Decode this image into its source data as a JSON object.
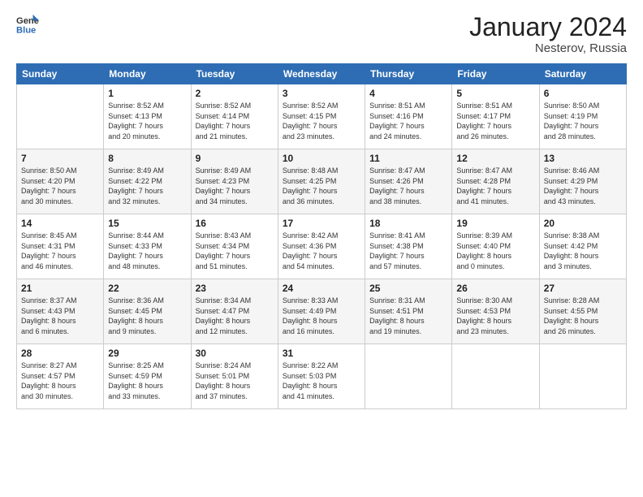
{
  "header": {
    "logo_general": "General",
    "logo_blue": "Blue",
    "month_title": "January 2024",
    "location": "Nesterov, Russia"
  },
  "weekdays": [
    "Sunday",
    "Monday",
    "Tuesday",
    "Wednesday",
    "Thursday",
    "Friday",
    "Saturday"
  ],
  "weeks": [
    [
      {
        "day": "",
        "info": ""
      },
      {
        "day": "1",
        "info": "Sunrise: 8:52 AM\nSunset: 4:13 PM\nDaylight: 7 hours\nand 20 minutes."
      },
      {
        "day": "2",
        "info": "Sunrise: 8:52 AM\nSunset: 4:14 PM\nDaylight: 7 hours\nand 21 minutes."
      },
      {
        "day": "3",
        "info": "Sunrise: 8:52 AM\nSunset: 4:15 PM\nDaylight: 7 hours\nand 23 minutes."
      },
      {
        "day": "4",
        "info": "Sunrise: 8:51 AM\nSunset: 4:16 PM\nDaylight: 7 hours\nand 24 minutes."
      },
      {
        "day": "5",
        "info": "Sunrise: 8:51 AM\nSunset: 4:17 PM\nDaylight: 7 hours\nand 26 minutes."
      },
      {
        "day": "6",
        "info": "Sunrise: 8:50 AM\nSunset: 4:19 PM\nDaylight: 7 hours\nand 28 minutes."
      }
    ],
    [
      {
        "day": "7",
        "info": "Sunrise: 8:50 AM\nSunset: 4:20 PM\nDaylight: 7 hours\nand 30 minutes."
      },
      {
        "day": "8",
        "info": "Sunrise: 8:49 AM\nSunset: 4:22 PM\nDaylight: 7 hours\nand 32 minutes."
      },
      {
        "day": "9",
        "info": "Sunrise: 8:49 AM\nSunset: 4:23 PM\nDaylight: 7 hours\nand 34 minutes."
      },
      {
        "day": "10",
        "info": "Sunrise: 8:48 AM\nSunset: 4:25 PM\nDaylight: 7 hours\nand 36 minutes."
      },
      {
        "day": "11",
        "info": "Sunrise: 8:47 AM\nSunset: 4:26 PM\nDaylight: 7 hours\nand 38 minutes."
      },
      {
        "day": "12",
        "info": "Sunrise: 8:47 AM\nSunset: 4:28 PM\nDaylight: 7 hours\nand 41 minutes."
      },
      {
        "day": "13",
        "info": "Sunrise: 8:46 AM\nSunset: 4:29 PM\nDaylight: 7 hours\nand 43 minutes."
      }
    ],
    [
      {
        "day": "14",
        "info": "Sunrise: 8:45 AM\nSunset: 4:31 PM\nDaylight: 7 hours\nand 46 minutes."
      },
      {
        "day": "15",
        "info": "Sunrise: 8:44 AM\nSunset: 4:33 PM\nDaylight: 7 hours\nand 48 minutes."
      },
      {
        "day": "16",
        "info": "Sunrise: 8:43 AM\nSunset: 4:34 PM\nDaylight: 7 hours\nand 51 minutes."
      },
      {
        "day": "17",
        "info": "Sunrise: 8:42 AM\nSunset: 4:36 PM\nDaylight: 7 hours\nand 54 minutes."
      },
      {
        "day": "18",
        "info": "Sunrise: 8:41 AM\nSunset: 4:38 PM\nDaylight: 7 hours\nand 57 minutes."
      },
      {
        "day": "19",
        "info": "Sunrise: 8:39 AM\nSunset: 4:40 PM\nDaylight: 8 hours\nand 0 minutes."
      },
      {
        "day": "20",
        "info": "Sunrise: 8:38 AM\nSunset: 4:42 PM\nDaylight: 8 hours\nand 3 minutes."
      }
    ],
    [
      {
        "day": "21",
        "info": "Sunrise: 8:37 AM\nSunset: 4:43 PM\nDaylight: 8 hours\nand 6 minutes."
      },
      {
        "day": "22",
        "info": "Sunrise: 8:36 AM\nSunset: 4:45 PM\nDaylight: 8 hours\nand 9 minutes."
      },
      {
        "day": "23",
        "info": "Sunrise: 8:34 AM\nSunset: 4:47 PM\nDaylight: 8 hours\nand 12 minutes."
      },
      {
        "day": "24",
        "info": "Sunrise: 8:33 AM\nSunset: 4:49 PM\nDaylight: 8 hours\nand 16 minutes."
      },
      {
        "day": "25",
        "info": "Sunrise: 8:31 AM\nSunset: 4:51 PM\nDaylight: 8 hours\nand 19 minutes."
      },
      {
        "day": "26",
        "info": "Sunrise: 8:30 AM\nSunset: 4:53 PM\nDaylight: 8 hours\nand 23 minutes."
      },
      {
        "day": "27",
        "info": "Sunrise: 8:28 AM\nSunset: 4:55 PM\nDaylight: 8 hours\nand 26 minutes."
      }
    ],
    [
      {
        "day": "28",
        "info": "Sunrise: 8:27 AM\nSunset: 4:57 PM\nDaylight: 8 hours\nand 30 minutes."
      },
      {
        "day": "29",
        "info": "Sunrise: 8:25 AM\nSunset: 4:59 PM\nDaylight: 8 hours\nand 33 minutes."
      },
      {
        "day": "30",
        "info": "Sunrise: 8:24 AM\nSunset: 5:01 PM\nDaylight: 8 hours\nand 37 minutes."
      },
      {
        "day": "31",
        "info": "Sunrise: 8:22 AM\nSunset: 5:03 PM\nDaylight: 8 hours\nand 41 minutes."
      },
      {
        "day": "",
        "info": ""
      },
      {
        "day": "",
        "info": ""
      },
      {
        "day": "",
        "info": ""
      }
    ]
  ]
}
